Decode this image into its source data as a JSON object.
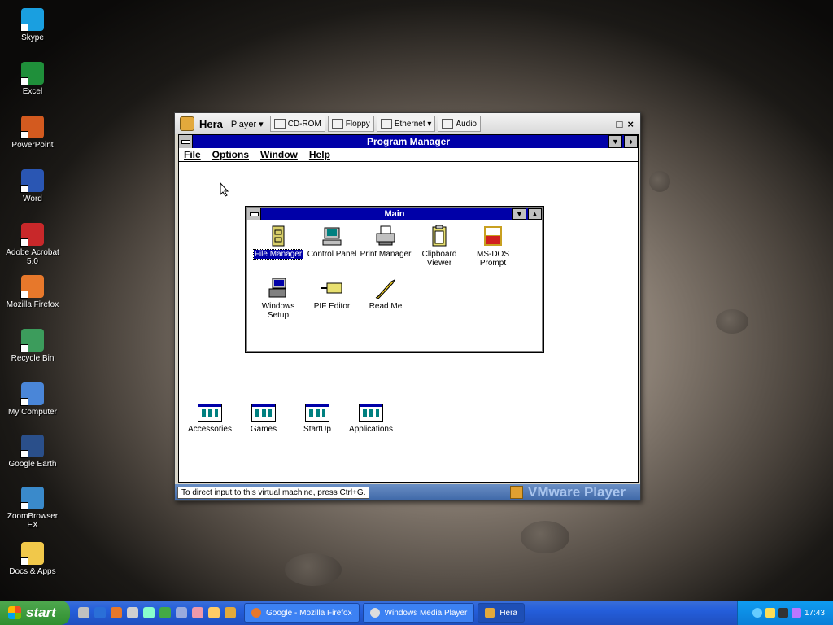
{
  "desktop": {
    "icons": [
      {
        "label": "Skype",
        "color": "#1a9fe0"
      },
      {
        "label": "Excel",
        "color": "#1f8f3a"
      },
      {
        "label": "PowerPoint",
        "color": "#d35a1f"
      },
      {
        "label": "Word",
        "color": "#2a56b3"
      },
      {
        "label": "Adobe Acrobat 5.0",
        "color": "#c8282a"
      },
      {
        "label": "Mozilla Firefox",
        "color": "#e7782b"
      },
      {
        "label": "Recycle Bin",
        "color": "#3c9c5c"
      },
      {
        "label": "My Computer",
        "color": "#4a86d8"
      },
      {
        "label": "Google Earth",
        "color": "#2a4f8a"
      },
      {
        "label": "ZoomBrowser EX",
        "color": "#3a8acb"
      },
      {
        "label": "Docs & Apps",
        "color": "#f1c84a"
      }
    ]
  },
  "vmware": {
    "title": "Hera",
    "player_menu": "Player ▾",
    "devices": [
      "CD-ROM",
      "Floppy",
      "Ethernet ▾",
      "Audio"
    ],
    "controls": [
      "_",
      "□",
      "×"
    ],
    "status_text": "To direct input to this virtual machine, press Ctrl+G.",
    "brand": "VMware Player"
  },
  "program_manager": {
    "title": "Program Manager",
    "menu": [
      "File",
      "Options",
      "Window",
      "Help"
    ],
    "main_group": {
      "title": "Main",
      "items": [
        {
          "label": "File Manager",
          "selected": true
        },
        {
          "label": "Control Panel",
          "selected": false
        },
        {
          "label": "Print Manager",
          "selected": false
        },
        {
          "label": "Clipboard Viewer",
          "selected": false
        },
        {
          "label": "MS-DOS Prompt",
          "selected": false
        },
        {
          "label": "Windows Setup",
          "selected": false
        },
        {
          "label": "PIF Editor",
          "selected": false
        },
        {
          "label": "Read Me",
          "selected": false
        }
      ]
    },
    "minimized_groups": [
      "Accessories",
      "Games",
      "StartUp",
      "Applications"
    ]
  },
  "taskbar": {
    "start_label": "start",
    "tasks": [
      {
        "label": "Google - Mozilla Firefox",
        "active": false
      },
      {
        "label": "Windows Media Player",
        "active": false
      },
      {
        "label": "Hera",
        "active": true
      }
    ],
    "clock": "17:43"
  }
}
